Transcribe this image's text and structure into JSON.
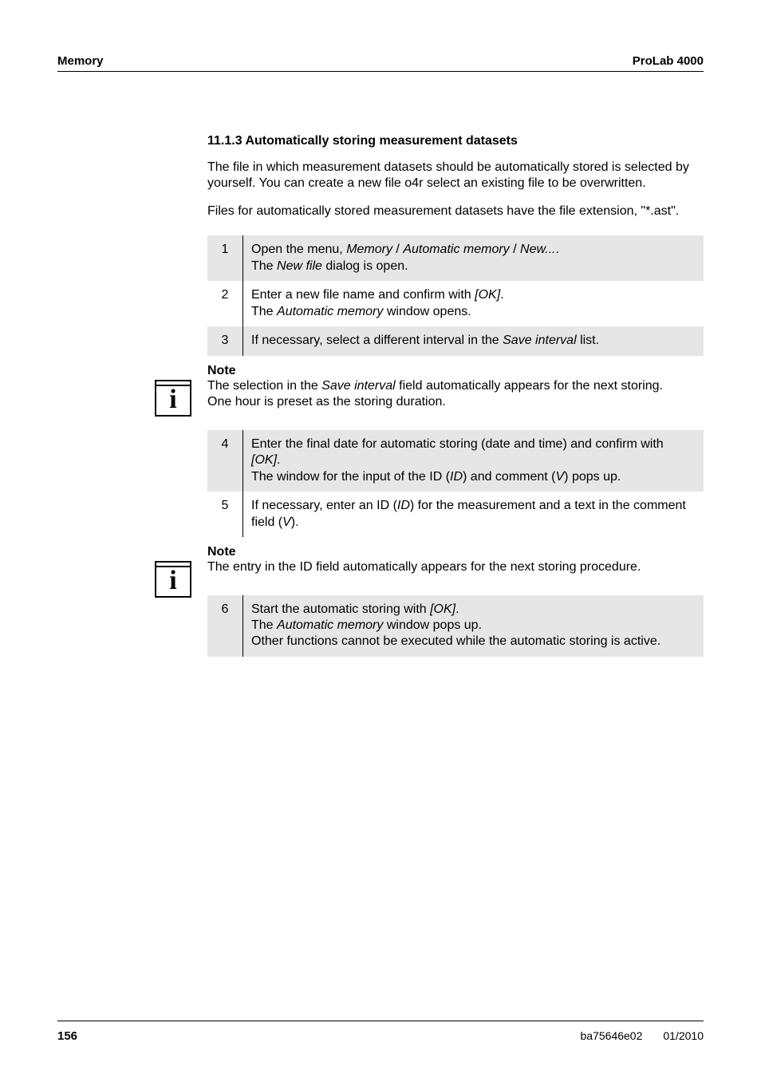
{
  "header": {
    "left": "Memory",
    "right": "ProLab 4000"
  },
  "section": {
    "heading_prefix": "11.1.3 ",
    "heading": "Automatically storing measurement datasets",
    "para1": "The file in which measurement datasets should be automatically stored is selected by yourself. You can create a new file o4r select an existing file to be overwritten.",
    "para2": "Files for automatically stored measurement datasets have the file extension, \"*.ast\"."
  },
  "steps1": [
    {
      "num": "1",
      "shaded": true,
      "parts": [
        {
          "text": "Open the menu, "
        },
        {
          "text": "Memory",
          "italic": true
        },
        {
          "text": " / "
        },
        {
          "text": "Automatic memory",
          "italic": true
        },
        {
          "text": " / "
        },
        {
          "text": "New...",
          "italic": true
        },
        {
          "text": ".",
          "br": true
        },
        {
          "text": "The "
        },
        {
          "text": "New file",
          "italic": true
        },
        {
          "text": " dialog is open."
        }
      ]
    },
    {
      "num": "2",
      "shaded": false,
      "parts": [
        {
          "text": "Enter a new file name and confirm with "
        },
        {
          "text": "[OK]",
          "italic": true
        },
        {
          "text": ".",
          "br": true
        },
        {
          "text": "The "
        },
        {
          "text": "Automatic memory",
          "italic": true
        },
        {
          "text": " window opens."
        }
      ]
    },
    {
      "num": "3",
      "shaded": true,
      "parts": [
        {
          "text": "If necessary, select a different interval in the "
        },
        {
          "text": "Save interval",
          "italic": true
        },
        {
          "text": " list."
        }
      ]
    }
  ],
  "note1": {
    "heading": "Note",
    "line1_pre": "The selection in the ",
    "line1_em": "Save interval",
    "line1_post": " field automatically appears for the next storing.",
    "line2": "One hour is preset as the storing duration."
  },
  "steps2": [
    {
      "num": "4",
      "shaded": true,
      "parts": [
        {
          "text": "Enter the final date for automatic storing (date and time) and confirm with "
        },
        {
          "text": "[OK]",
          "italic": true
        },
        {
          "text": ".",
          "br": true
        },
        {
          "text": "The window for the input of the ID ("
        },
        {
          "text": "ID",
          "italic": true
        },
        {
          "text": ") and comment ("
        },
        {
          "text": "V",
          "italic": true
        },
        {
          "text": ") pops up."
        }
      ]
    },
    {
      "num": "5",
      "shaded": false,
      "parts": [
        {
          "text": "If necessary, enter an ID ("
        },
        {
          "text": "ID",
          "italic": true
        },
        {
          "text": ") for the measurement and a text in the comment field ("
        },
        {
          "text": "V",
          "italic": true
        },
        {
          "text": ")."
        }
      ]
    }
  ],
  "note2": {
    "heading": "Note",
    "body": "The entry in the ID field automatically appears for the next storing procedure."
  },
  "steps3": [
    {
      "num": "6",
      "shaded": true,
      "parts": [
        {
          "text": "Start the automatic storing with "
        },
        {
          "text": "[OK]",
          "italic": true
        },
        {
          "text": ".",
          "br": true
        },
        {
          "text": "The "
        },
        {
          "text": "Automatic memory",
          "italic": true
        },
        {
          "text": " window pops up.",
          "br": true
        },
        {
          "text": "Other functions cannot be executed while the automatic storing is active."
        }
      ]
    }
  ],
  "footer": {
    "page": "156",
    "doc": "ba75646e02",
    "date": "01/2010"
  },
  "icon_glyph": "i"
}
